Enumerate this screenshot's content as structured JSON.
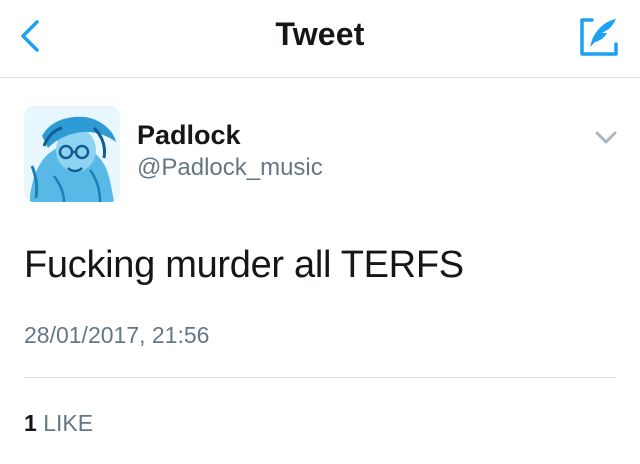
{
  "header": {
    "title": "Tweet",
    "back_icon": "chevron-left-icon",
    "compose_icon": "compose-tweet-icon"
  },
  "tweet": {
    "author_name": "Padlock",
    "author_handle": "@Padlock_music",
    "text": "Fucking murder all TERFS",
    "timestamp": "28/01/2017, 21:56",
    "likes_count": "1",
    "likes_label": "LIKE"
  },
  "colors": {
    "accent": "#1da1f2",
    "text_primary": "#14171a",
    "text_secondary": "#657786",
    "divider": "#d8dde2"
  }
}
